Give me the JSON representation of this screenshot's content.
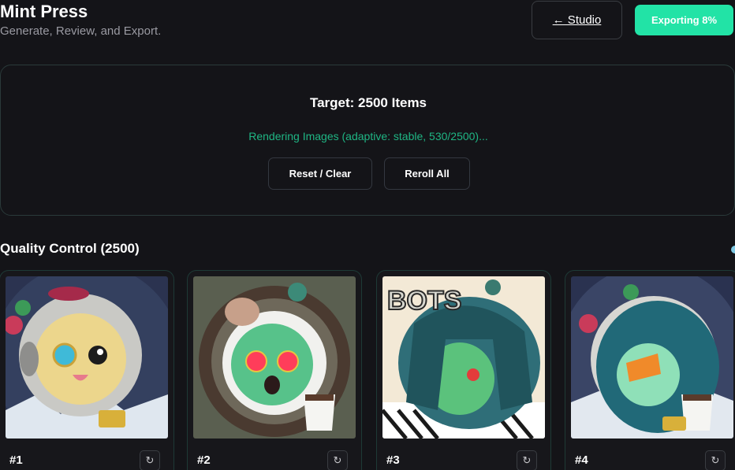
{
  "header": {
    "title": "Mint Press",
    "subtitle": "Generate, Review, and Export.",
    "studio_label": "← Studio",
    "export_label": "Exporting 8%"
  },
  "panel": {
    "target": "Target: 2500 Items",
    "status": "Rendering Images (adaptive: stable, 530/2500)...",
    "reset_label": "Reset / Clear",
    "reroll_all_label": "Reroll All"
  },
  "quality_control": {
    "heading": "Quality Control (2500)",
    "cards": [
      {
        "label": "#1",
        "reroll_icon": "↻"
      },
      {
        "label": "#2",
        "reroll_icon": "↻"
      },
      {
        "label": "#3",
        "reroll_icon": "↻"
      },
      {
        "label": "#4",
        "reroll_icon": "↻"
      }
    ]
  },
  "colors": {
    "accent": "#22e3a6",
    "status_green": "#1fb684",
    "background": "#141418"
  }
}
